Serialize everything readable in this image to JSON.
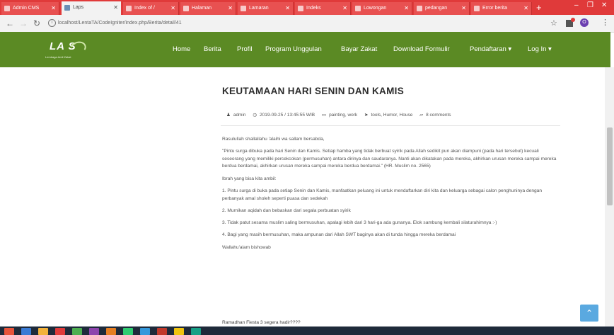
{
  "browser": {
    "tabs": [
      {
        "label": "Admin CMS"
      },
      {
        "label": "Laps"
      },
      {
        "label": "Index of /"
      },
      {
        "label": "Halaman"
      },
      {
        "label": "Lamaran"
      },
      {
        "label": "Indeks"
      },
      {
        "label": "Lowongan"
      },
      {
        "label": "pedangan"
      },
      {
        "label": "Error berita"
      }
    ],
    "url": "localhost/LentaTA/CodeIgniter/index.php/Berita/detail/41"
  },
  "site": {
    "logo_text": "LA S",
    "logo_sub": "Lembaga Amil Zakat",
    "nav": [
      {
        "label": "Home"
      },
      {
        "label": "Berita"
      },
      {
        "label": "Profil"
      },
      {
        "label": "Program Unggulan"
      },
      {
        "label": "Bayar Zakat"
      },
      {
        "label": "Download Formulir"
      },
      {
        "label": "Pendaftaran ▾"
      },
      {
        "label": "Log In ▾"
      }
    ]
  },
  "article": {
    "title": "KEUTAMAAN HARI SENIN DAN KAMIS",
    "author": "admin",
    "datetime": "2019-09-25 / 13:45:55 WIB",
    "categories": "painting, work",
    "tags": "tools, Humor, House",
    "comments": "8 comments",
    "paragraphs": [
      "Rasulullah shallallahu 'alaihi wa sallam bersabda,",
      "\"Pintu surga dibuka pada hari Senin dan Kamis. Setiap hamba yang tidak berbuat syirik pada Allah sedikit pun akan diampuni (pada hari tersebut) kecuali seseorang yang memiliki percekcokan (permusuhan) antara dirinya dan saudaranya. Nanti akan dikatakan pada mereka, akhirkan urusan mereka sampai mereka berdua berdamai, akhirkan urusan mereka sampai mereka berdua berdamai.\" (HR. Muslim no. 2565)",
      "Ibrah yang bisa kita ambil:",
      "1. Pintu surga di buka pada setiap Senin dan Kamis, manfaatkan peluang ini untuk mendaftarkan diri kita dan keluarga sebagai calon penghuninya dengan perbanyak amal sholeh seperti puasa dan sedekah",
      "2. Murnikan aqidah dan bebaskan dari segala perbuatan syirik",
      "3. Tidak patut sesama muslim saling bermusuhan, apalagi lebih dari 3 hari-ga ada gunanya. Elok sambung kembali silaturahimnya :-)",
      "4. Bagi yang masih bermusuhan, maka ampunan dari Allah SWT baginya akan di tunda hingga mereka berdamai",
      "Wallahu'alam bishowab"
    ],
    "next_line": "Ramadhan Fiesta 3 segera hadir????"
  }
}
